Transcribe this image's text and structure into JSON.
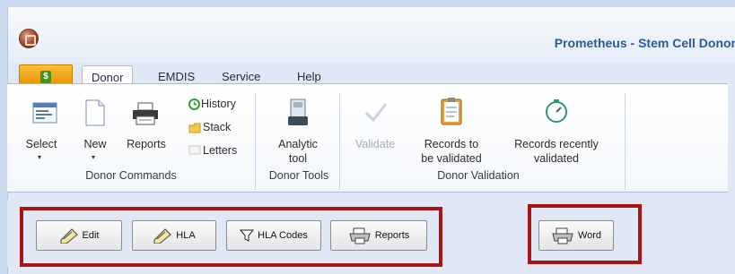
{
  "window": {
    "title": "Prometheus - Stem Cell Donor"
  },
  "tabs": [
    {
      "label": "Donor",
      "active": true
    },
    {
      "label": "EMDIS",
      "active": false
    },
    {
      "label": "Service",
      "active": false
    },
    {
      "label": "Help",
      "active": false
    }
  ],
  "ribbon": {
    "donor_commands": {
      "group_label": "Donor Commands",
      "select": "Select",
      "new": "New",
      "reports": "Reports",
      "history": "History",
      "stack": "Stack",
      "letters": "Letters"
    },
    "donor_tools": {
      "group_label": "Donor Tools",
      "analytic_line1": "Analytic",
      "analytic_line2": "tool"
    },
    "donor_validation": {
      "group_label": "Donor Validation",
      "validate": "Validate",
      "records_tbv_line1": "Records to",
      "records_tbv_line2": "be validated",
      "records_rv_line1": "Records recently",
      "records_rv_line2": "validated"
    }
  },
  "toolbar": {
    "edit": "Edit",
    "hla": "HLA",
    "hla_codes": "HLA Codes",
    "reports": "Reports",
    "word": "Word"
  },
  "colors": {
    "highlight_box": "#a61616",
    "title_text": "#2b5a96",
    "file_button": "#f0a114"
  }
}
